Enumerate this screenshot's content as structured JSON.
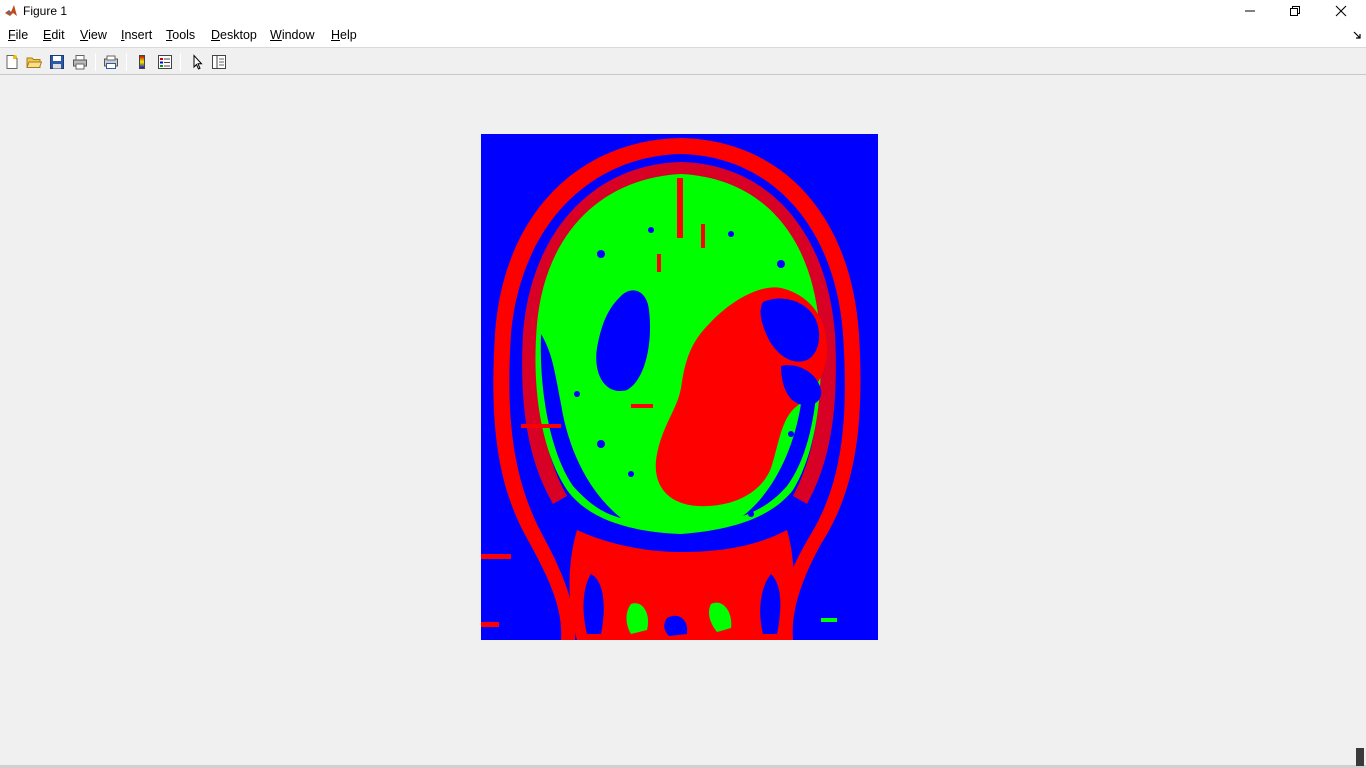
{
  "window": {
    "title": "Figure 1",
    "controls": [
      "minimize-icon",
      "restore-icon",
      "close-icon"
    ]
  },
  "menubar": {
    "items": [
      "File",
      "Edit",
      "View",
      "Insert",
      "Tools",
      "Desktop",
      "Window",
      "Help"
    ]
  },
  "toolbar": {
    "buttons": [
      "new-figure-icon",
      "open-file-icon",
      "save-icon",
      "print-icon",
      "print-preview-icon",
      "colorbar-icon",
      "legend-icon",
      "edit-plot-arrow-icon",
      "property-inspector-icon"
    ]
  },
  "figure": {
    "image": "segmented brain MRI, 3-class color map",
    "colors": {
      "background_class": "#0000ff",
      "class_2": "#00ff00",
      "class_3": "#ff0000"
    }
  },
  "colors": {
    "window_bg": "#f0f0f0",
    "titlebar_bg": "#ffffff"
  }
}
